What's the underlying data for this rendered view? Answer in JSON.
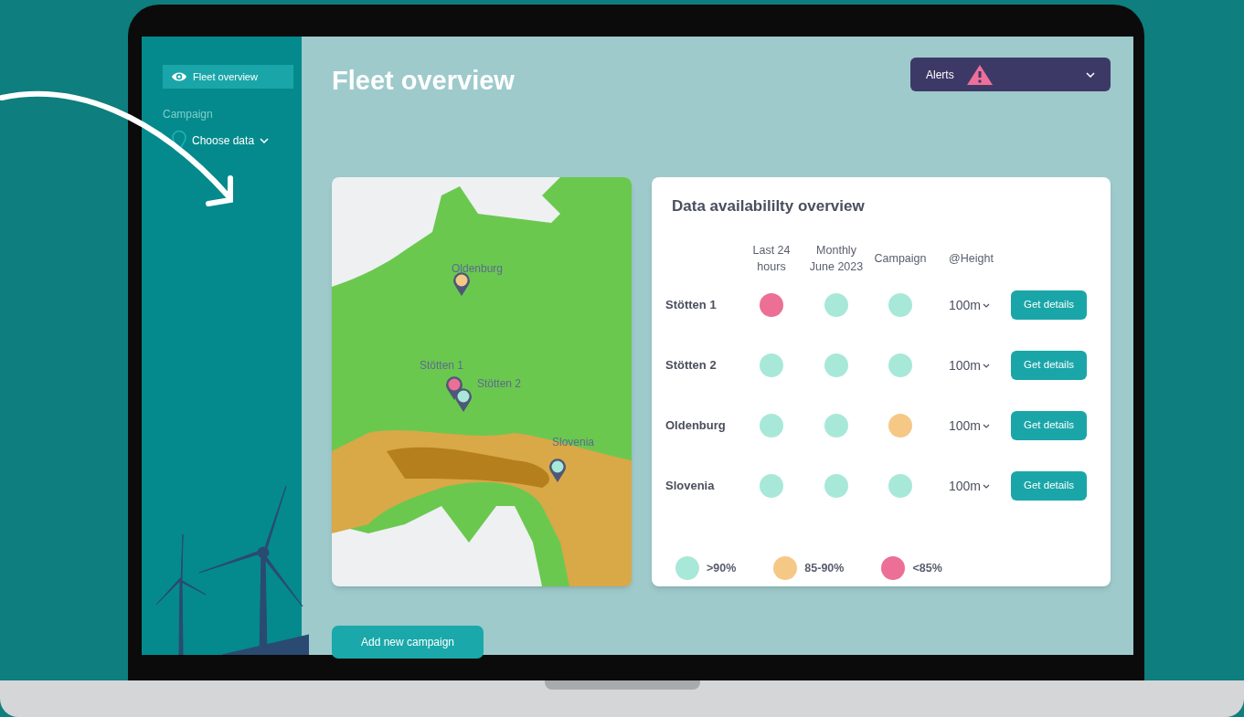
{
  "sidebar": {
    "items": [
      {
        "label": "Fleet overview",
        "selected": true
      }
    ],
    "section_label": "Campaign",
    "campaign_picker": {
      "label": "Choose data"
    }
  },
  "header": {
    "title": "Fleet overview",
    "alerts": {
      "label": "Alerts"
    }
  },
  "map": {
    "pins": [
      {
        "label": "Oldenburg",
        "color": "#f6c886"
      },
      {
        "label": "Stötten 1",
        "color": "#ec6f96"
      },
      {
        "label": "Stötten 2",
        "color": "#a8e8d8"
      },
      {
        "label": "Slovenia",
        "color": "#a8e8d8"
      }
    ]
  },
  "availability": {
    "title": "Data availabililty overview",
    "columns": [
      "Last 24 hours",
      "Monthly June 2023",
      "Campaign",
      "@Height"
    ],
    "rows": [
      {
        "name": "Stötten 1",
        "cells": [
          {
            "color": "#ec6f96"
          },
          {
            "color": "#a8e8d8"
          },
          {
            "color": "#a8e8d8"
          }
        ],
        "height": "100m",
        "button": "Get details"
      },
      {
        "name": "Stötten 2",
        "cells": [
          {
            "color": "#a8e8d8"
          },
          {
            "color": "#a8e8d8"
          },
          {
            "color": "#a8e8d8"
          }
        ],
        "height": "100m",
        "button": "Get details"
      },
      {
        "name": "Oldenburg",
        "cells": [
          {
            "color": "#a8e8d8"
          },
          {
            "color": "#a8e8d8"
          },
          {
            "color": "#f6c886"
          }
        ],
        "height": "100m",
        "button": "Get details"
      },
      {
        "name": "Slovenia",
        "cells": [
          {
            "color": "#a8e8d8"
          },
          {
            "color": "#a8e8d8"
          },
          {
            "color": "#a8e8d8"
          }
        ],
        "height": "100m",
        "button": "Get details"
      }
    ],
    "legend": [
      {
        "label": ">90%",
        "color": "#a8e8d8"
      },
      {
        "label": "85-90%",
        "color": "#f6c886"
      },
      {
        "label": "<85%",
        "color": "#ec6f96"
      }
    ]
  },
  "add_button": "Add new campaign"
}
